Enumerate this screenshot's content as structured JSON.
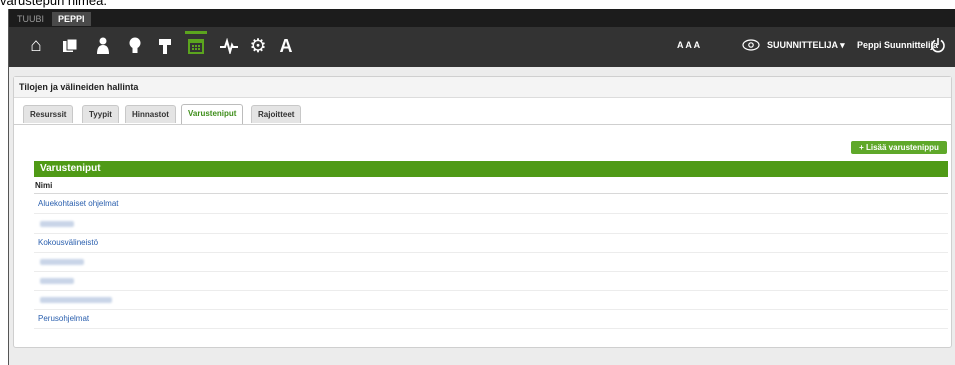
{
  "caption": "varustepun nimeä.",
  "app_tabs": [
    "TUUBI",
    "PEPPI"
  ],
  "header": {
    "font_sizes": "A A A",
    "role": "SUUNNITTELIJA",
    "user": "Peppi Suunnittelija"
  },
  "nav_icons": [
    "home-icon",
    "pages-icon",
    "person-icon",
    "bulb-icon",
    "hammer-icon",
    "calendar-icon",
    "activity-icon",
    "gear-icon",
    "font-icon"
  ],
  "panel": {
    "title": "Tilojen ja välineiden hallinta",
    "tabs": [
      "Resurssit",
      "Tyypit",
      "Hinnastot",
      "Varusteniput",
      "Rajoitteet"
    ],
    "active_tab": "Varusteniput",
    "add_button": "+ Lisää varustenippu",
    "section_title": "Varusteniput",
    "column_header": "Nimi",
    "rows": [
      "Aluekohtaiset ohjelmat",
      "",
      "Kokousvälineistö",
      "",
      "",
      "",
      "Perusohjelmat"
    ]
  },
  "colors": {
    "accent": "#4f9a16",
    "link": "#2a5fae",
    "topbar": "#333333"
  }
}
